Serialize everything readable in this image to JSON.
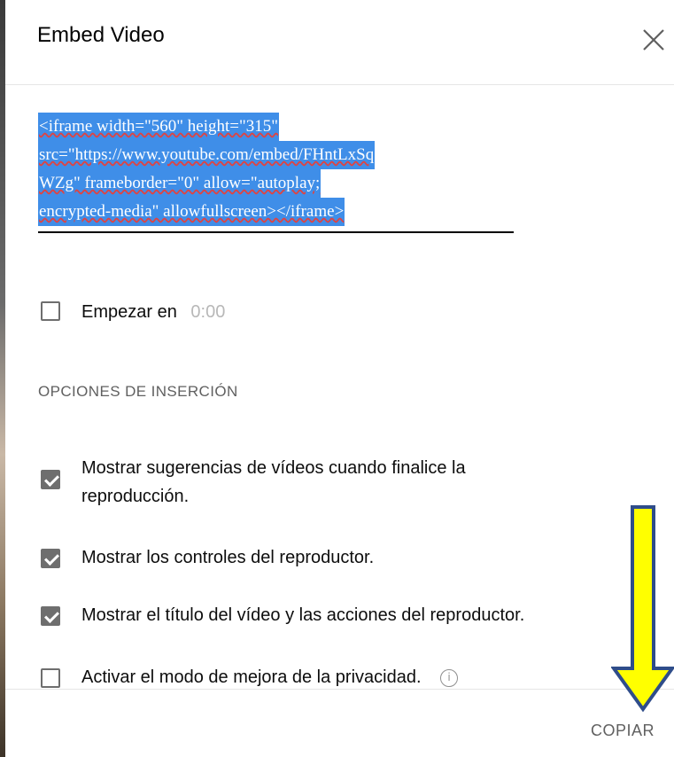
{
  "dialog": {
    "title": "Embed Video",
    "embed_code": [
      "<iframe width=\"560\" height=\"315\"",
      "src=\"https://www.youtube.com/embed/FHntLxSq",
      "WZg\" frameborder=\"0\" allow=\"autoplay;",
      "encrypted-media\" allowfullscreen></iframe>"
    ],
    "start_at": {
      "label": "Empezar en",
      "value": "0:00",
      "checked": false
    },
    "options_title": "OPCIONES DE INSERCIÓN",
    "options": [
      {
        "line1": "Mostrar sugerencias de vídeos cuando finalice la",
        "line2": "reproducción.",
        "checked": true
      },
      {
        "line1": "Mostrar los controles del reproductor.",
        "checked": true
      },
      {
        "line1": "Mostrar el título del vídeo y las acciones del reproductor.",
        "checked": true
      },
      {
        "line1": "Activar el modo de mejora de la privacidad.",
        "checked": false
      }
    ],
    "info_icon": "info-icon",
    "copy_label": "COPIAR",
    "close_icon": "close-icon"
  },
  "annotation": {
    "arrow_color": "#ffff00",
    "arrow_border": "#2f4d8a"
  }
}
